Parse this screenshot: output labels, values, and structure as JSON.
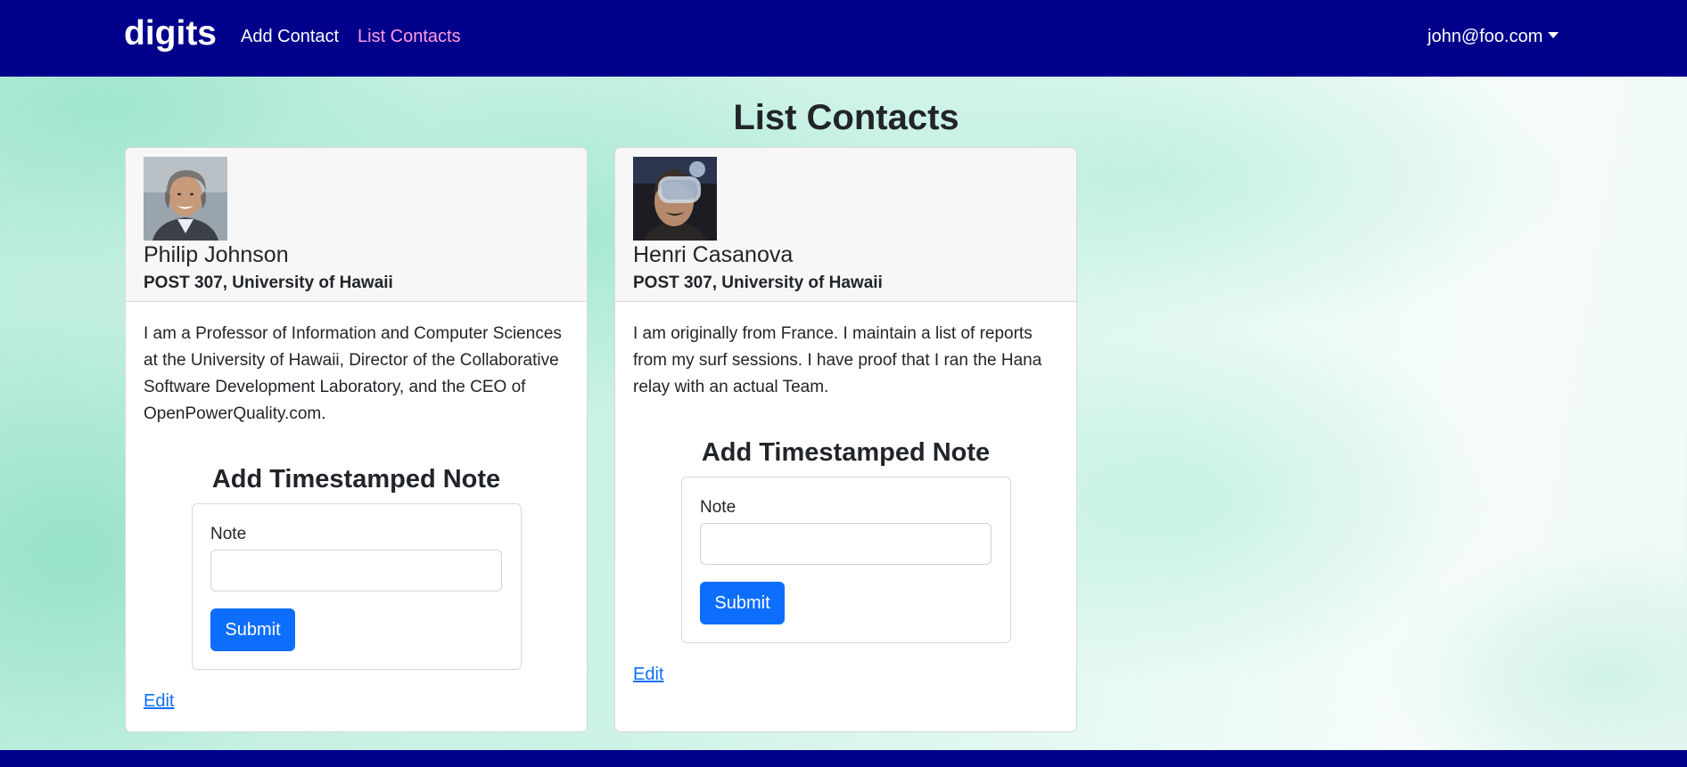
{
  "navbar": {
    "brand": "digits",
    "links": [
      {
        "label": "Add Contact",
        "active": false
      },
      {
        "label": "List Contacts",
        "active": true
      }
    ],
    "user": "john@foo.com",
    "background": "#00008b",
    "active_link_color": "#ff9de0"
  },
  "page": {
    "title": "List Contacts"
  },
  "contacts": [
    {
      "name": "Philip Johnson",
      "address": "POST 307, University of Hawaii",
      "description": "I am a Professor of Information and Computer Sciences at the University of Hawaii, Director of the Collaborative Software Development Laboratory, and the CEO of OpenPowerQuality.com.",
      "note_heading": "Add Timestamped Note",
      "note_label": "Note",
      "note_value": "",
      "submit_label": "Submit",
      "edit_label": "Edit"
    },
    {
      "name": "Henri Casanova",
      "address": "POST 307, University of Hawaii",
      "description": "I am originally from France. I maintain a list of reports from my surf sessions. I have proof that I ran the Hana relay with an actual Team.",
      "note_heading": "Add Timestamped Note",
      "note_label": "Note",
      "note_value": "",
      "submit_label": "Submit",
      "edit_label": "Edit"
    }
  ],
  "colors": {
    "primary": "#0d6efd",
    "footer": "#00008b"
  }
}
